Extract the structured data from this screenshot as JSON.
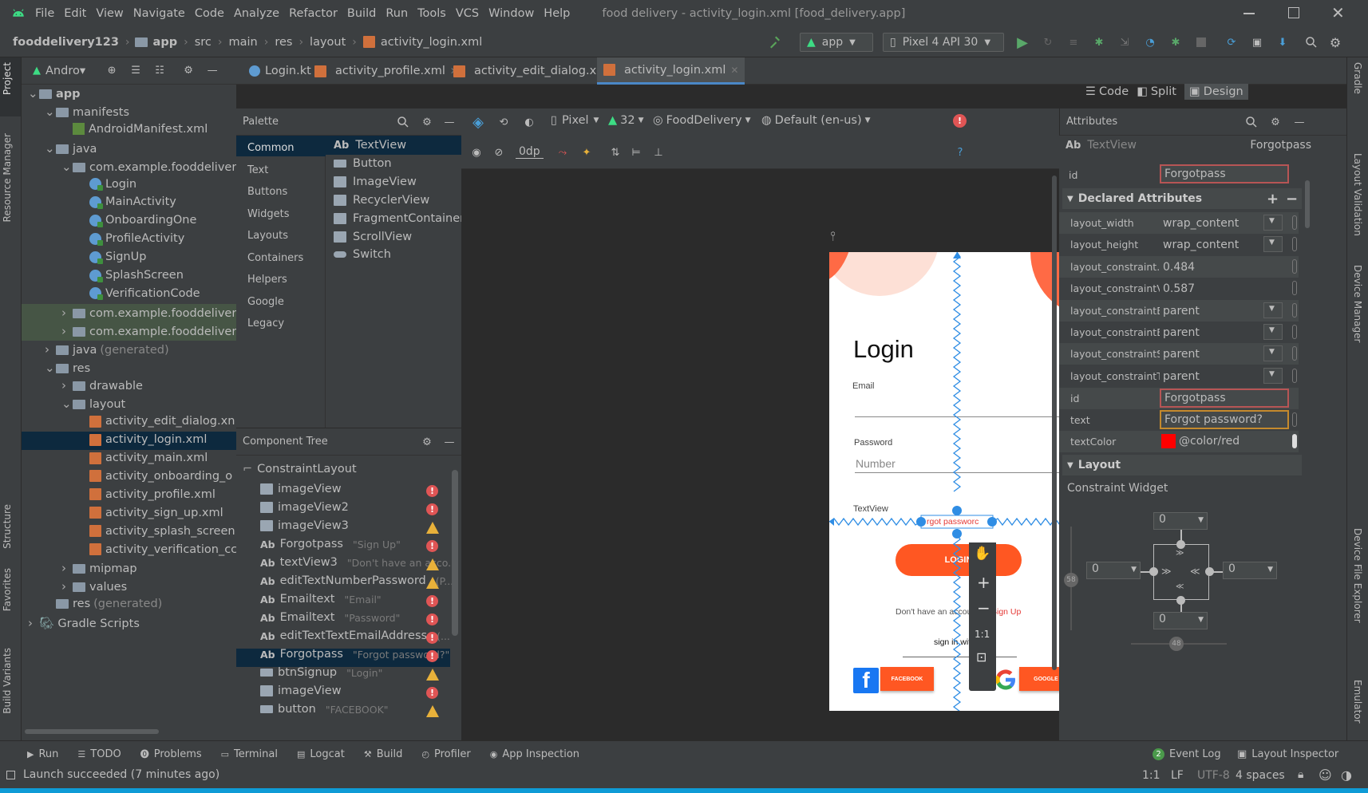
{
  "menubar": {
    "items": [
      "File",
      "Edit",
      "View",
      "Navigate",
      "Code",
      "Analyze",
      "Refactor",
      "Build",
      "Run",
      "Tools",
      "VCS",
      "Window",
      "Help"
    ],
    "title": "food delivery - activity_login.xml [food_delivery.app]"
  },
  "navbar": {
    "crumbs": [
      "fooddelivery123",
      "app",
      "src",
      "main",
      "res",
      "layout"
    ],
    "file": "activity_login.xml",
    "run_config": "app",
    "device": "Pixel 4 API 30"
  },
  "project": {
    "selector": "Andro▾",
    "tree": [
      {
        "label": "app",
        "depth": 0,
        "expanded": true,
        "kind": "module"
      },
      {
        "label": "manifests",
        "depth": 1,
        "expanded": true,
        "kind": "folder"
      },
      {
        "label": "AndroidManifest.xml",
        "depth": 2,
        "kind": "manifest"
      },
      {
        "label": "java",
        "depth": 1,
        "expanded": true,
        "kind": "folder"
      },
      {
        "label": "com.example.fooddeliver",
        "depth": 2,
        "expanded": true,
        "kind": "package"
      },
      {
        "label": "Login",
        "depth": 3,
        "kind": "class"
      },
      {
        "label": "MainActivity",
        "depth": 3,
        "kind": "class"
      },
      {
        "label": "OnboardingOne",
        "depth": 3,
        "kind": "class"
      },
      {
        "label": "ProfileActivity",
        "depth": 3,
        "kind": "class"
      },
      {
        "label": "SignUp",
        "depth": 3,
        "kind": "class"
      },
      {
        "label": "SplashScreen",
        "depth": 3,
        "kind": "class"
      },
      {
        "label": "VerificationCode",
        "depth": 3,
        "kind": "class"
      },
      {
        "label": "com.example.fooddeliver",
        "depth": 2,
        "expanded": false,
        "kind": "package"
      },
      {
        "label": "com.example.fooddeliver",
        "depth": 2,
        "expanded": false,
        "kind": "package"
      },
      {
        "label": "java",
        "extra": "(generated)",
        "depth": 1,
        "expanded": false,
        "kind": "folder"
      },
      {
        "label": "res",
        "depth": 1,
        "expanded": true,
        "kind": "folder"
      },
      {
        "label": "drawable",
        "depth": 2,
        "expanded": false,
        "kind": "folder"
      },
      {
        "label": "layout",
        "depth": 2,
        "expanded": true,
        "kind": "folder"
      },
      {
        "label": "activity_edit_dialog.xn",
        "depth": 3,
        "kind": "xml"
      },
      {
        "label": "activity_login.xml",
        "depth": 3,
        "kind": "xml",
        "selected": true
      },
      {
        "label": "activity_main.xml",
        "depth": 3,
        "kind": "xml"
      },
      {
        "label": "activity_onboarding_o",
        "depth": 3,
        "kind": "xml"
      },
      {
        "label": "activity_profile.xml",
        "depth": 3,
        "kind": "xml"
      },
      {
        "label": "activity_sign_up.xml",
        "depth": 3,
        "kind": "xml"
      },
      {
        "label": "activity_splash_screen.",
        "depth": 3,
        "kind": "xml"
      },
      {
        "label": "activity_verification_cc",
        "depth": 3,
        "kind": "xml"
      },
      {
        "label": "mipmap",
        "depth": 2,
        "expanded": false,
        "kind": "folder"
      },
      {
        "label": "values",
        "depth": 2,
        "expanded": false,
        "kind": "folder"
      },
      {
        "label": "res",
        "extra": "(generated)",
        "depth": 1,
        "kind": "folder"
      },
      {
        "label": "Gradle Scripts",
        "depth": 0,
        "expanded": false,
        "kind": "gradle"
      }
    ]
  },
  "left_strip": [
    "Project",
    "Resource Manager",
    "Structure",
    "Favorites",
    "Build Variants"
  ],
  "right_strip": [
    "Gradle",
    "Layout Validation",
    "Device Manager",
    "Device File Explorer",
    "Emulator"
  ],
  "tabs": [
    {
      "label": "Login.kt",
      "kind": "kt"
    },
    {
      "label": "activity_profile.xml",
      "kind": "xml"
    },
    {
      "label": "activity_edit_dialog.xml",
      "kind": "xml"
    },
    {
      "label": "activity_login.xml",
      "kind": "xml",
      "active": true
    }
  ],
  "view_modes": {
    "code": "Code",
    "split": "Split",
    "design": "Design"
  },
  "palette": {
    "title": "Palette",
    "categories": [
      "Common",
      "Text",
      "Buttons",
      "Widgets",
      "Layouts",
      "Containers",
      "Helpers",
      "Google",
      "Legacy"
    ],
    "items": [
      "TextView",
      "Button",
      "ImageView",
      "RecyclerView",
      "FragmentContainerVi...",
      "ScrollView",
      "Switch"
    ],
    "textview_prefix": "Ab"
  },
  "component_tree": {
    "title": "Component Tree",
    "root": "ConstraintLayout",
    "rows": [
      {
        "label": "imageView",
        "sub": "",
        "status": "error",
        "icon": "img"
      },
      {
        "label": "imageView2",
        "sub": "",
        "status": "error",
        "icon": "img"
      },
      {
        "label": "imageView3",
        "sub": "",
        "status": "warn",
        "icon": "img"
      },
      {
        "label": "Forgotpass",
        "sub": "\"Sign Up\"",
        "status": "error",
        "icon": "ab"
      },
      {
        "label": "textView3",
        "sub": "\"Don't have an acco...",
        "status": "warn",
        "icon": "ab"
      },
      {
        "label": "editTextNumberPassword",
        "sub": "(P...",
        "status": "warn",
        "icon": "ab"
      },
      {
        "label": "Emailtext",
        "sub": "\"Email\"",
        "status": "error",
        "icon": "ab"
      },
      {
        "label": "Emailtext",
        "sub": "\"Password\"",
        "status": "error",
        "icon": "ab"
      },
      {
        "label": "editTextTextEmailAddress",
        "sub": "(...",
        "status": "error",
        "icon": "ab"
      },
      {
        "label": "Forgotpass",
        "sub": "\"Forgot password?\"",
        "status": "error",
        "icon": "ab",
        "selected": true
      },
      {
        "label": "btnSignup",
        "sub": "\"Login\"",
        "status": "warn",
        "icon": "btn"
      },
      {
        "label": "imageView",
        "sub": "",
        "status": "error",
        "icon": "img"
      },
      {
        "label": "button",
        "sub": "\"FACEBOOK\"",
        "status": "warn",
        "icon": "btn"
      }
    ]
  },
  "design_toolbar": {
    "margin": "0dp",
    "device": "Pixel",
    "api": "32",
    "theme": "FoodDelivery",
    "locale": "Default (en-us)"
  },
  "phone": {
    "title": "Login",
    "email_label": "Email",
    "password_label": "Password",
    "password_hint": "Number",
    "textview_label": "TextView",
    "forgot": "Forgot password?",
    "forgot_visible": "rgot passworc",
    "login_button": "LOGIN",
    "no_account": "Don't have an account?",
    "sign_up": "Sign Up",
    "sign_in_with": "sign in with",
    "facebook": "FACEBOOK",
    "google": "GOOGLE"
  },
  "zoom": {
    "one_to_one": "1:1"
  },
  "attributes": {
    "title": "Attributes",
    "widget_kind": "TextView",
    "widget_id": "Forgotpass",
    "id_label": "id",
    "id_value": "Forgotpass",
    "declared_title": "Declared Attributes",
    "declared": [
      {
        "key": "layout_width",
        "value": "wrap_content",
        "dropdown": true
      },
      {
        "key": "layout_height",
        "value": "wrap_content",
        "dropdown": true
      },
      {
        "key": "layout_constraint...",
        "value": "0.484",
        "dropdown": false
      },
      {
        "key": "layout_constraintV...",
        "value": "0.587",
        "dropdown": false
      },
      {
        "key": "layout_constraintB...",
        "value": "parent",
        "dropdown": true
      },
      {
        "key": "layout_constraintE...",
        "value": "parent",
        "dropdown": true
      },
      {
        "key": "layout_constraintS...",
        "value": "parent",
        "dropdown": true
      },
      {
        "key": "layout_constraintT...",
        "value": "parent",
        "dropdown": true
      }
    ],
    "id2_label": "id",
    "id2_value": "Forgotpass",
    "text_label": "text",
    "text_value": "Forgot password?",
    "textcolor_label": "textColor",
    "textcolor_value": "@color/red",
    "textcolor_swatch": "#ff0000",
    "layout_title": "Layout",
    "constraint_widget": "Constraint Widget",
    "margins": {
      "top": "0",
      "left": "0",
      "right": "0",
      "bottom": "0"
    },
    "bias_v": "58",
    "bias_h": "48"
  },
  "bottom_tabs": [
    "Run",
    "TODO",
    "Problems",
    "Terminal",
    "Logcat",
    "Build",
    "Profiler",
    "App Inspection"
  ],
  "bottom_right": {
    "event_log": "Event Log",
    "event_count": "2",
    "layout_inspector": "Layout Inspector"
  },
  "status": {
    "message": "Launch succeeded (7 minutes ago)",
    "position": "1:1",
    "line_sep": "LF",
    "encoding": "UTF-8",
    "indent": "4 spaces"
  },
  "colors": {
    "accent_orange": "#ff5722",
    "blueprint": "#2f8de4",
    "selection": "#0d293e",
    "error": "#e05555",
    "warning": "#e8b13a"
  }
}
